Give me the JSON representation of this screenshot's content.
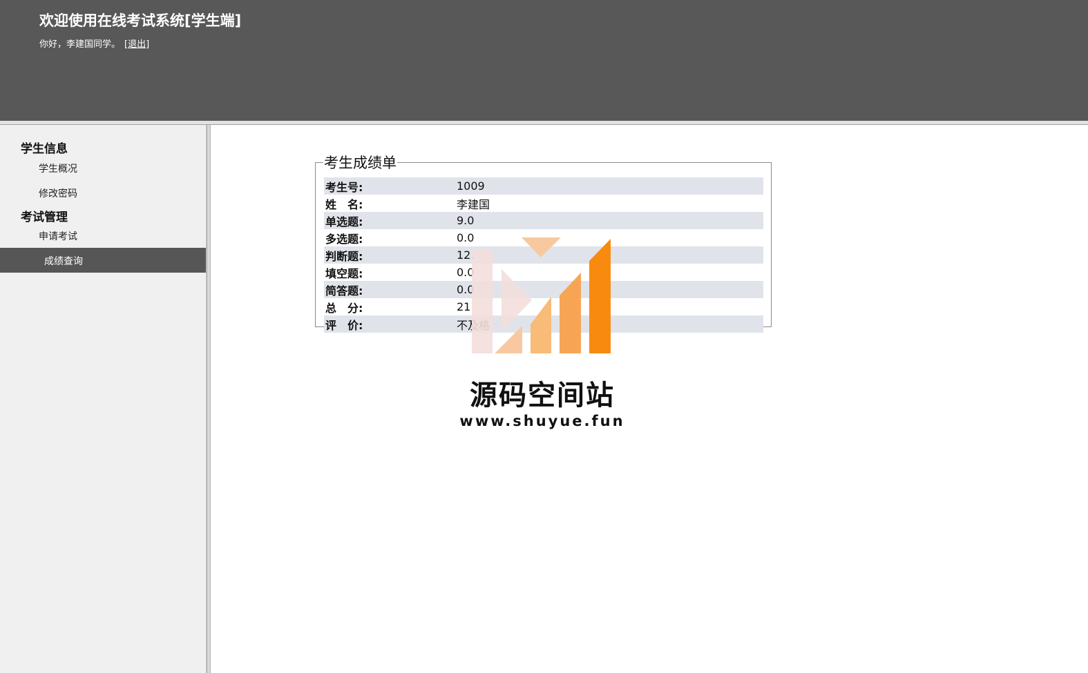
{
  "header": {
    "title": "欢迎使用在线考试系统[学生端]",
    "greeting": "你好，李建国同学。",
    "logout_open": "[",
    "logout_label": "退出",
    "logout_close": "]"
  },
  "sidebar": {
    "groups": [
      {
        "label": "学生信息",
        "items": [
          {
            "label": "学生概况"
          },
          {
            "label": "修改密码"
          }
        ]
      },
      {
        "label": "考试管理",
        "items": [
          {
            "label": "申请考试"
          },
          {
            "label": "成绩查询",
            "active": true
          }
        ]
      }
    ]
  },
  "score_card": {
    "legend": "考生成绩单",
    "rows": [
      {
        "label": "考生号:",
        "value": "1009"
      },
      {
        "label": "姓　名:",
        "value": "李建国"
      },
      {
        "label": "单选题:",
        "value": "9.0"
      },
      {
        "label": "多选题:",
        "value": "0.0"
      },
      {
        "label": "判断题:",
        "value": "12."
      },
      {
        "label": "填空题:",
        "value": "0.0"
      },
      {
        "label": "简答题:",
        "value": "0.0"
      },
      {
        "label": "总　分:",
        "value": "21"
      },
      {
        "label": "评　价:",
        "value": "不及格"
      }
    ]
  },
  "watermark": {
    "title": "源码空间站",
    "url": "www.shuyue.fun",
    "colors": {
      "bar_light": "#f8c9a0",
      "bar_mid": "#f7a555",
      "bar_dark": "#f88a10",
      "pink": "#f3dedd"
    }
  }
}
